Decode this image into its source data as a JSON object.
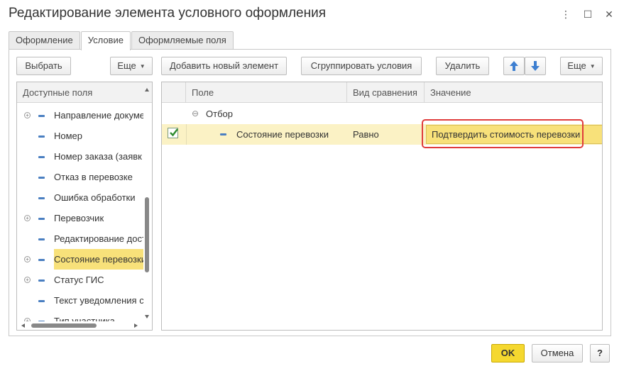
{
  "window": {
    "title": "Редактирование элемента условного оформления",
    "more_icon": "⋮",
    "maximize_icon": "☐",
    "close_icon": "✕"
  },
  "tabs": [
    {
      "label": "Оформление",
      "active": false
    },
    {
      "label": "Условие",
      "active": true
    },
    {
      "label": "Оформляемые поля",
      "active": false
    }
  ],
  "left": {
    "select_label": "Выбрать",
    "more_label": "Еще",
    "header": "Доступные поля",
    "items": [
      {
        "label": "Направление докуме",
        "expandable": true,
        "selected": false
      },
      {
        "label": "Номер",
        "expandable": false,
        "selected": false
      },
      {
        "label": "Номер заказа (заявк",
        "expandable": false,
        "selected": false
      },
      {
        "label": "Отказ в перевозке",
        "expandable": false,
        "selected": false
      },
      {
        "label": "Ошибка обработки",
        "expandable": false,
        "selected": false
      },
      {
        "label": "Перевозчик",
        "expandable": true,
        "selected": false
      },
      {
        "label": "Редактирование дост",
        "expandable": false,
        "selected": false
      },
      {
        "label": "Состояние перевозки",
        "expandable": true,
        "selected": true
      },
      {
        "label": "Статус ГИС",
        "expandable": true,
        "selected": false
      },
      {
        "label": "Текст уведомления с",
        "expandable": false,
        "selected": false
      },
      {
        "label": "Тип участника",
        "expandable": true,
        "selected": false
      }
    ]
  },
  "right": {
    "add_label": "Добавить новый элемент",
    "group_label": "Сгруппировать условия",
    "delete_label": "Удалить",
    "up_icon": "arrow-up-icon",
    "down_icon": "arrow-down-icon",
    "more_label": "Еще",
    "columns": {
      "field": "Поле",
      "comparison": "Вид сравнения",
      "value": "Значение"
    },
    "group_row": {
      "label": "Отбор",
      "toggle": "⊖"
    },
    "rows": [
      {
        "checked": true,
        "field": "Состояние перевозки",
        "comparison": "Равно",
        "value": "Подтвердить стоимость перевозки"
      }
    ]
  },
  "footer": {
    "ok_label": "OK",
    "cancel_label": "Отмена",
    "help_label": "?"
  },
  "colors": {
    "accent_yellow": "#f5d82f",
    "selected_row": "#fbf2c5",
    "selected_cell": "#f8e17a",
    "highlight_border": "#e03c3c",
    "arrow_blue": "#3d7fd1"
  }
}
